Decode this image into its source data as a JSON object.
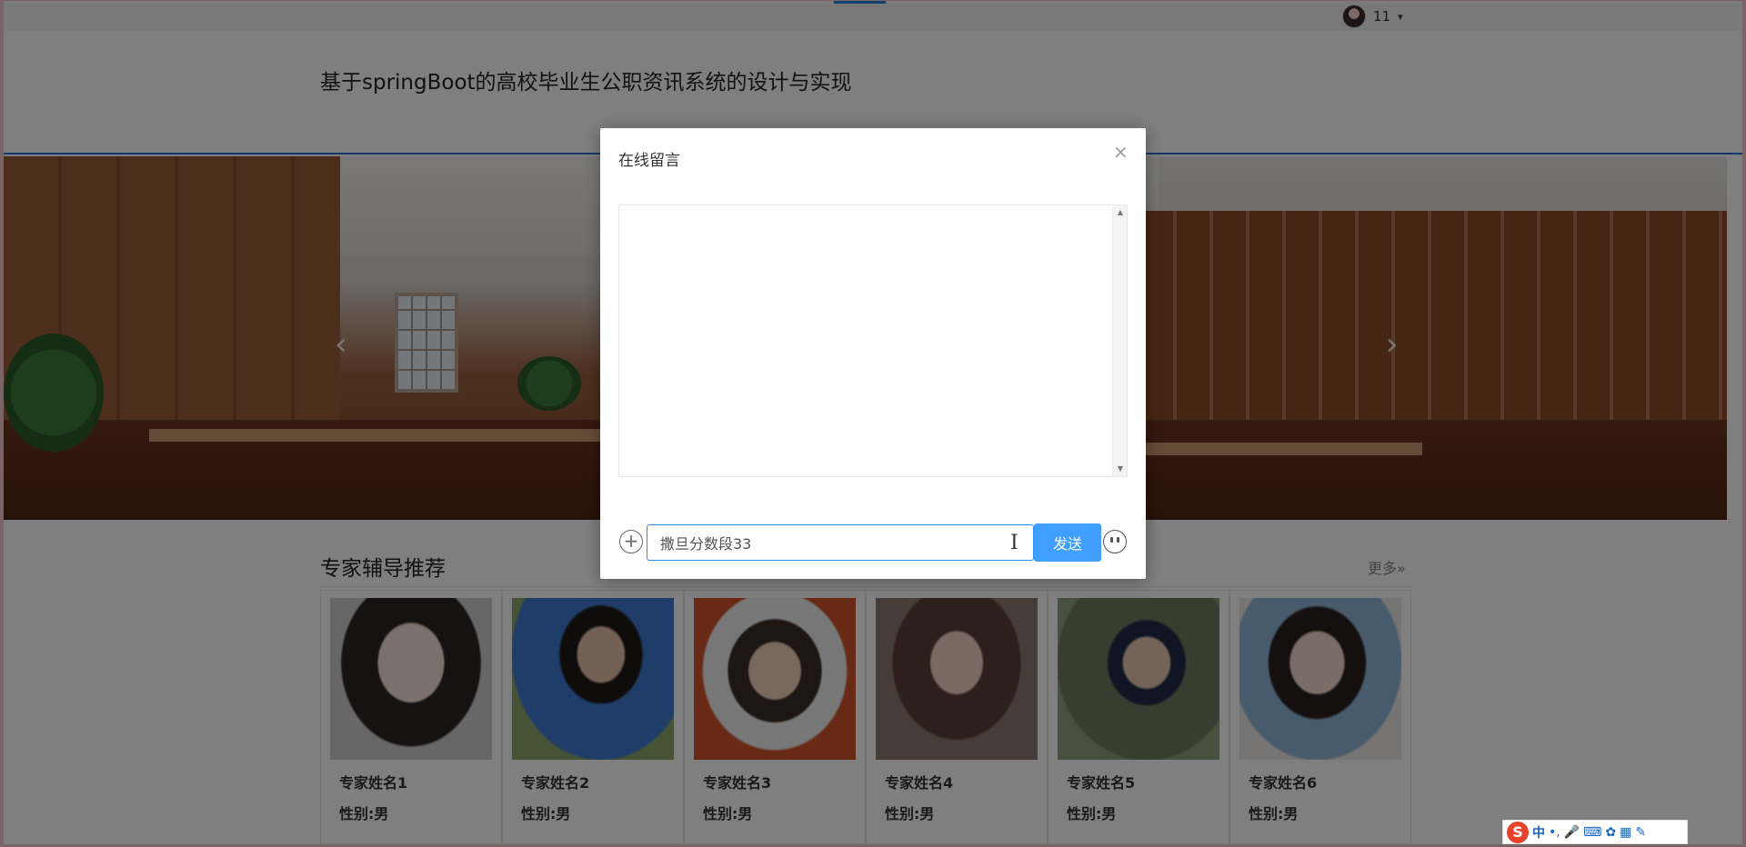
{
  "topbar": {
    "user_name": "11",
    "caret": "▾"
  },
  "header": {
    "title": "基于springBoot的高校毕业生公职资讯系统的设计与实现"
  },
  "banner": {
    "prev_arrow": "‹",
    "next_arrow": "›"
  },
  "experts": {
    "title": "专家辅导推荐",
    "more": "更多»",
    "cards": [
      {
        "name": "专家姓名1",
        "sex": "性别:男"
      },
      {
        "name": "专家姓名2",
        "sex": "性别:男"
      },
      {
        "name": "专家姓名3",
        "sex": "性别:男"
      },
      {
        "name": "专家姓名4",
        "sex": "性别:男"
      },
      {
        "name": "专家姓名5",
        "sex": "性别:男"
      },
      {
        "name": "专家姓名6",
        "sex": "性别:男"
      }
    ]
  },
  "modal": {
    "title": "在线留言",
    "close": "×",
    "input_value": "撒旦分数段33",
    "send_label": "发送",
    "plus": "+"
  },
  "ime": {
    "logo": "S",
    "lang": "中",
    "punct": "•,",
    "mic": "🎤",
    "keyboard": "⌨",
    "skin": "✿",
    "grid": "▦",
    "tool": "✎"
  },
  "colors": {
    "accent": "#409eff",
    "header_rule": "#2a6fd6",
    "overlay": "rgba(0,0,0,0.5)",
    "ime_logo": "#e8412c"
  }
}
